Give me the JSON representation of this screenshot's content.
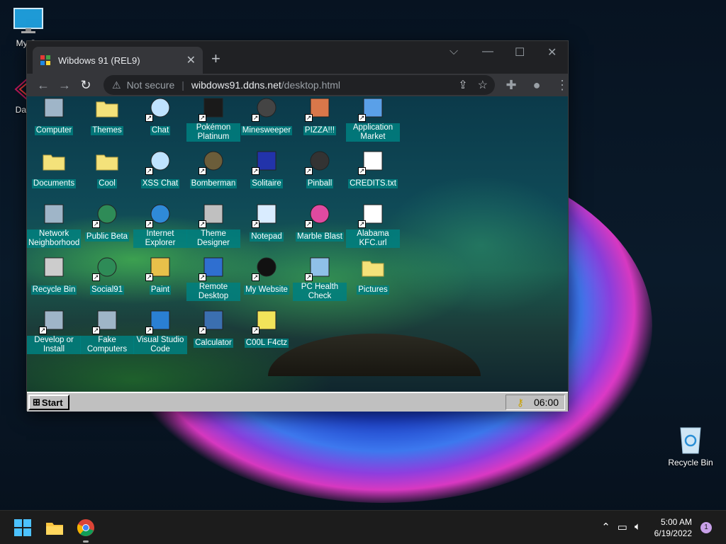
{
  "desktop": {
    "icons": [
      {
        "label": "My Co",
        "icon": "monitor-icon"
      },
      {
        "label": "DataW",
        "icon": "datawarp-icon"
      },
      {
        "label": "Recycle Bin",
        "icon": "recycle-bin-icon"
      }
    ]
  },
  "browser": {
    "tab_title": "Wibdows 91 (REL9)",
    "new_tab": "+",
    "tab_close": "✕",
    "window_controls": {
      "tab_search": "⌵",
      "minimize": "—",
      "maximize": "☐",
      "close": "✕"
    },
    "security_label": "Not secure",
    "url_host": "wibdows91.ddns.net",
    "url_path": "/desktop.html"
  },
  "wibdows": {
    "icons": [
      {
        "label": "Computer",
        "icon": "computer-icon"
      },
      {
        "label": "Themes",
        "icon": "folder-icon"
      },
      {
        "label": "Chat",
        "icon": "chat-icon"
      },
      {
        "label": "Pokémon Platinum",
        "icon": "giratina-icon"
      },
      {
        "label": "Minesweeper",
        "icon": "mine-icon"
      },
      {
        "label": "PIZZA!!!",
        "icon": "pizza-icon"
      },
      {
        "label": "Application Market",
        "icon": "shop-icon"
      },
      {
        "label": "Documents",
        "icon": "folder-docs-icon"
      },
      {
        "label": "Cool",
        "icon": "folder-icon"
      },
      {
        "label": "XSS Chat",
        "icon": "warning-chat-icon"
      },
      {
        "label": "Bomberman",
        "icon": "bomb-icon"
      },
      {
        "label": "Solitaire",
        "icon": "cards-icon"
      },
      {
        "label": "Pinball",
        "icon": "pinball-icon"
      },
      {
        "label": "CREDITS.txt",
        "icon": "text-file-icon"
      },
      {
        "label": "Network Neighborhood",
        "icon": "network-icon"
      },
      {
        "label": "Public Beta",
        "icon": "globe-icon"
      },
      {
        "label": "Internet Explorer",
        "icon": "ie-icon"
      },
      {
        "label": "Theme Designer",
        "icon": "window-icon"
      },
      {
        "label": "Notepad",
        "icon": "notepad-icon"
      },
      {
        "label": "Marble Blast",
        "icon": "marble-icon"
      },
      {
        "label": "Alabama KFC.url",
        "icon": "ie-page-icon"
      },
      {
        "label": "Recycle Bin",
        "icon": "recycle-bin-icon"
      },
      {
        "label": "Social91",
        "icon": "globe-icon"
      },
      {
        "label": "Paint",
        "icon": "paint-icon"
      },
      {
        "label": "Remote Desktop",
        "icon": "remote-desktop-icon"
      },
      {
        "label": "My Website",
        "icon": "github-icon"
      },
      {
        "label": "PC Health Check",
        "icon": "health-check-icon"
      },
      {
        "label": "Pictures",
        "icon": "folder-icon"
      },
      {
        "label": "Develop or Install",
        "icon": "help-setup-icon"
      },
      {
        "label": "Fake Computers",
        "icon": "computer-icon"
      },
      {
        "label": "Visual Studio Code",
        "icon": "vscode-icon"
      },
      {
        "label": "Calculator",
        "icon": "calculator-icon"
      },
      {
        "label": "C00L F4ctz",
        "icon": "lightbulb-icon"
      }
    ],
    "start_label": "Start",
    "clock": "06:00"
  },
  "taskbar": {
    "time": "5:00 AM",
    "date": "6/19/2022",
    "notifications": "1"
  },
  "colors": {
    "icon_label_bg": "#008080",
    "win95_gray": "#c0c0c0",
    "chrome_dark": "#202124"
  }
}
